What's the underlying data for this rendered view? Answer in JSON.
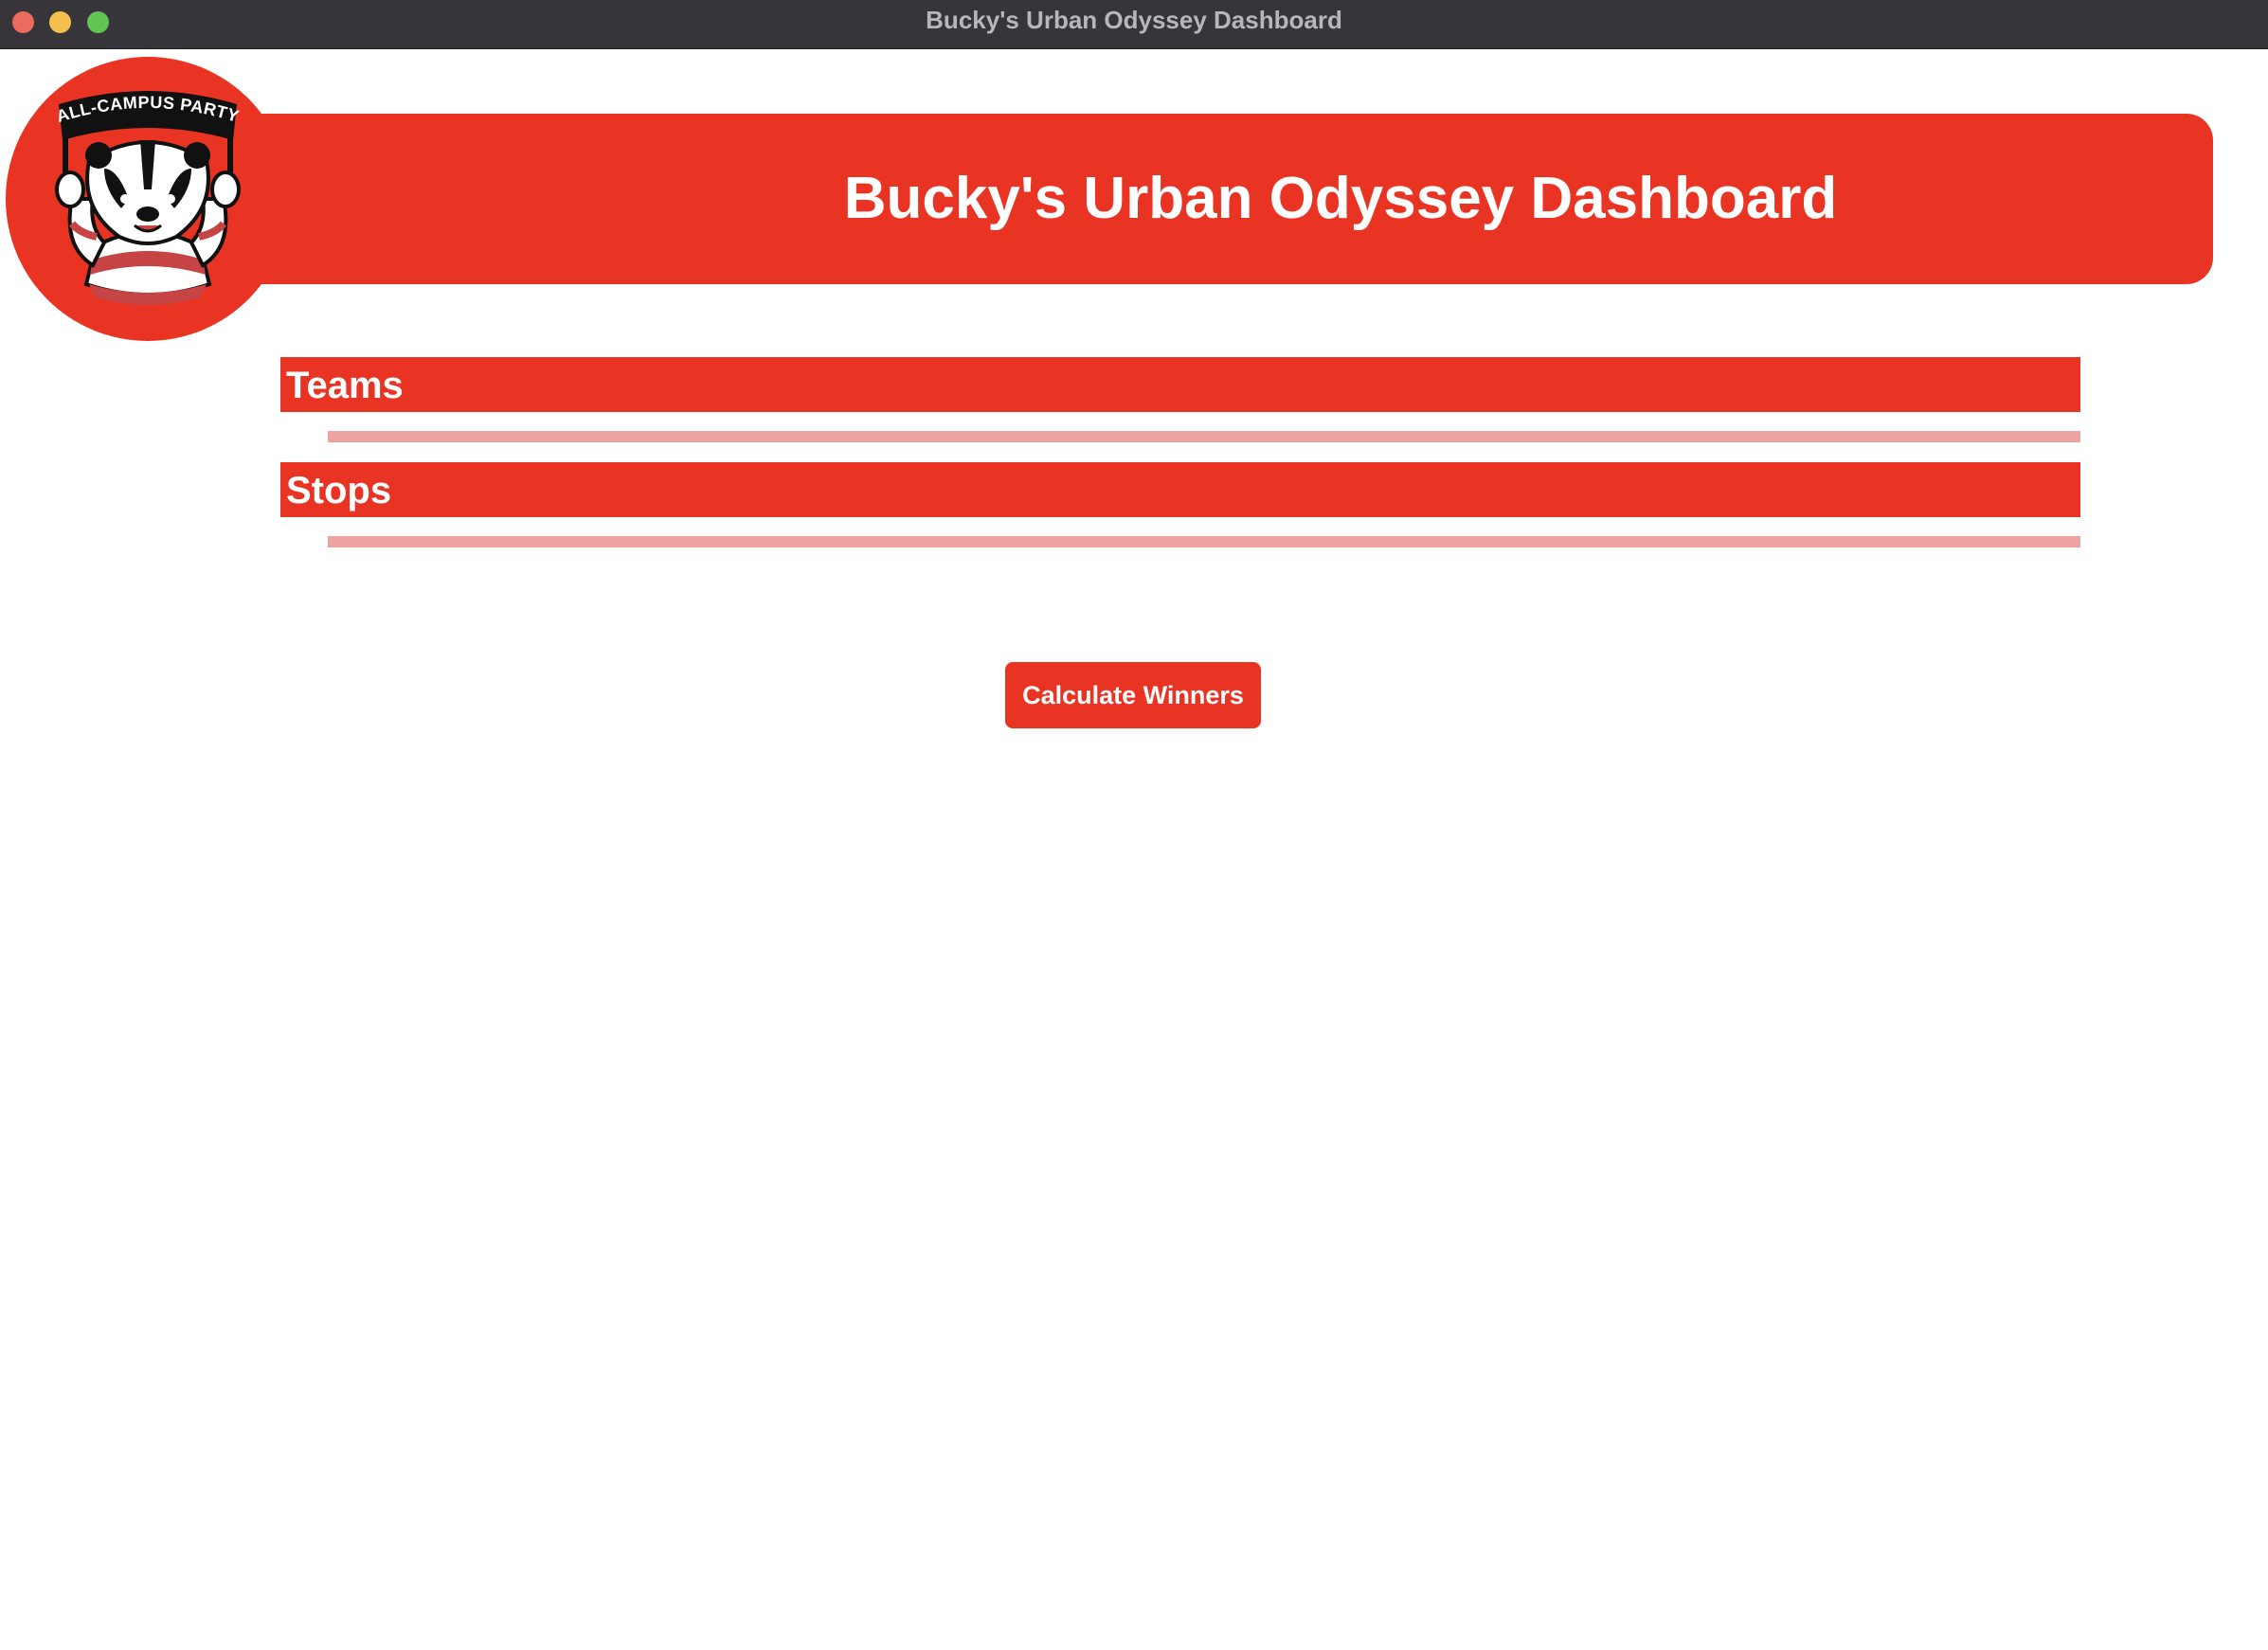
{
  "window": {
    "title": "Bucky's Urban Odyssey Dashboard"
  },
  "header": {
    "title": "Bucky's Urban Odyssey Dashboard",
    "logo_text": "ALL-CAMPUS PARTY"
  },
  "sections": [
    {
      "title": "Teams",
      "items": []
    },
    {
      "title": "Stops",
      "items": []
    }
  ],
  "actions": {
    "calculate_label": "Calculate Winners"
  },
  "colors": {
    "accent": "#e93424",
    "list_placeholder": "#eda3a1",
    "titlebar": "#37353a"
  }
}
